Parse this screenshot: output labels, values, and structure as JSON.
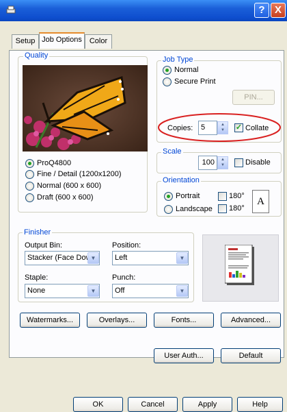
{
  "window": {
    "help_label": "?",
    "close_label": "X"
  },
  "tabs": [
    "Setup",
    "Job Options",
    "Color"
  ],
  "quality": {
    "group_label": "Quality",
    "options": [
      "ProQ4800",
      "Fine / Detail (1200x1200)",
      "Normal (600 x 600)",
      "Draft (600 x 600)"
    ],
    "selected": "ProQ4800"
  },
  "job_type": {
    "group_label": "Job Type",
    "options": [
      "Normal",
      "Secure Print"
    ],
    "selected": "Normal",
    "pin_label": "PIN...",
    "copies_label": "Copies:",
    "copies_value": "5",
    "collate_label": "Collate",
    "collate_checked": true
  },
  "scale": {
    "group_label": "Scale",
    "value": "100",
    "disable_label": "Disable"
  },
  "orientation": {
    "group_label": "Orientation",
    "portrait_label": "Portrait",
    "landscape_label": "Landscape",
    "rotate_label": "180°",
    "selected": "Portrait",
    "preview_letter": "A"
  },
  "finisher": {
    "group_label": "Finisher",
    "output_bin_label": "Output Bin:",
    "output_bin_value": "Stacker (Face Down)",
    "position_label": "Position:",
    "position_value": "Left",
    "staple_label": "Staple:",
    "staple_value": "None",
    "punch_label": "Punch:",
    "punch_value": "Off"
  },
  "buttons": {
    "watermarks": "Watermarks...",
    "overlays": "Overlays...",
    "fonts": "Fonts...",
    "advanced": "Advanced...",
    "user_auth": "User Auth...",
    "default": "Default"
  },
  "footer": {
    "ok": "OK",
    "cancel": "Cancel",
    "apply": "Apply",
    "help": "Help"
  },
  "colors": {
    "highlight_ellipse": "#d92020",
    "group_label": "#0046d5",
    "title_bar": "#1a5fd8"
  }
}
